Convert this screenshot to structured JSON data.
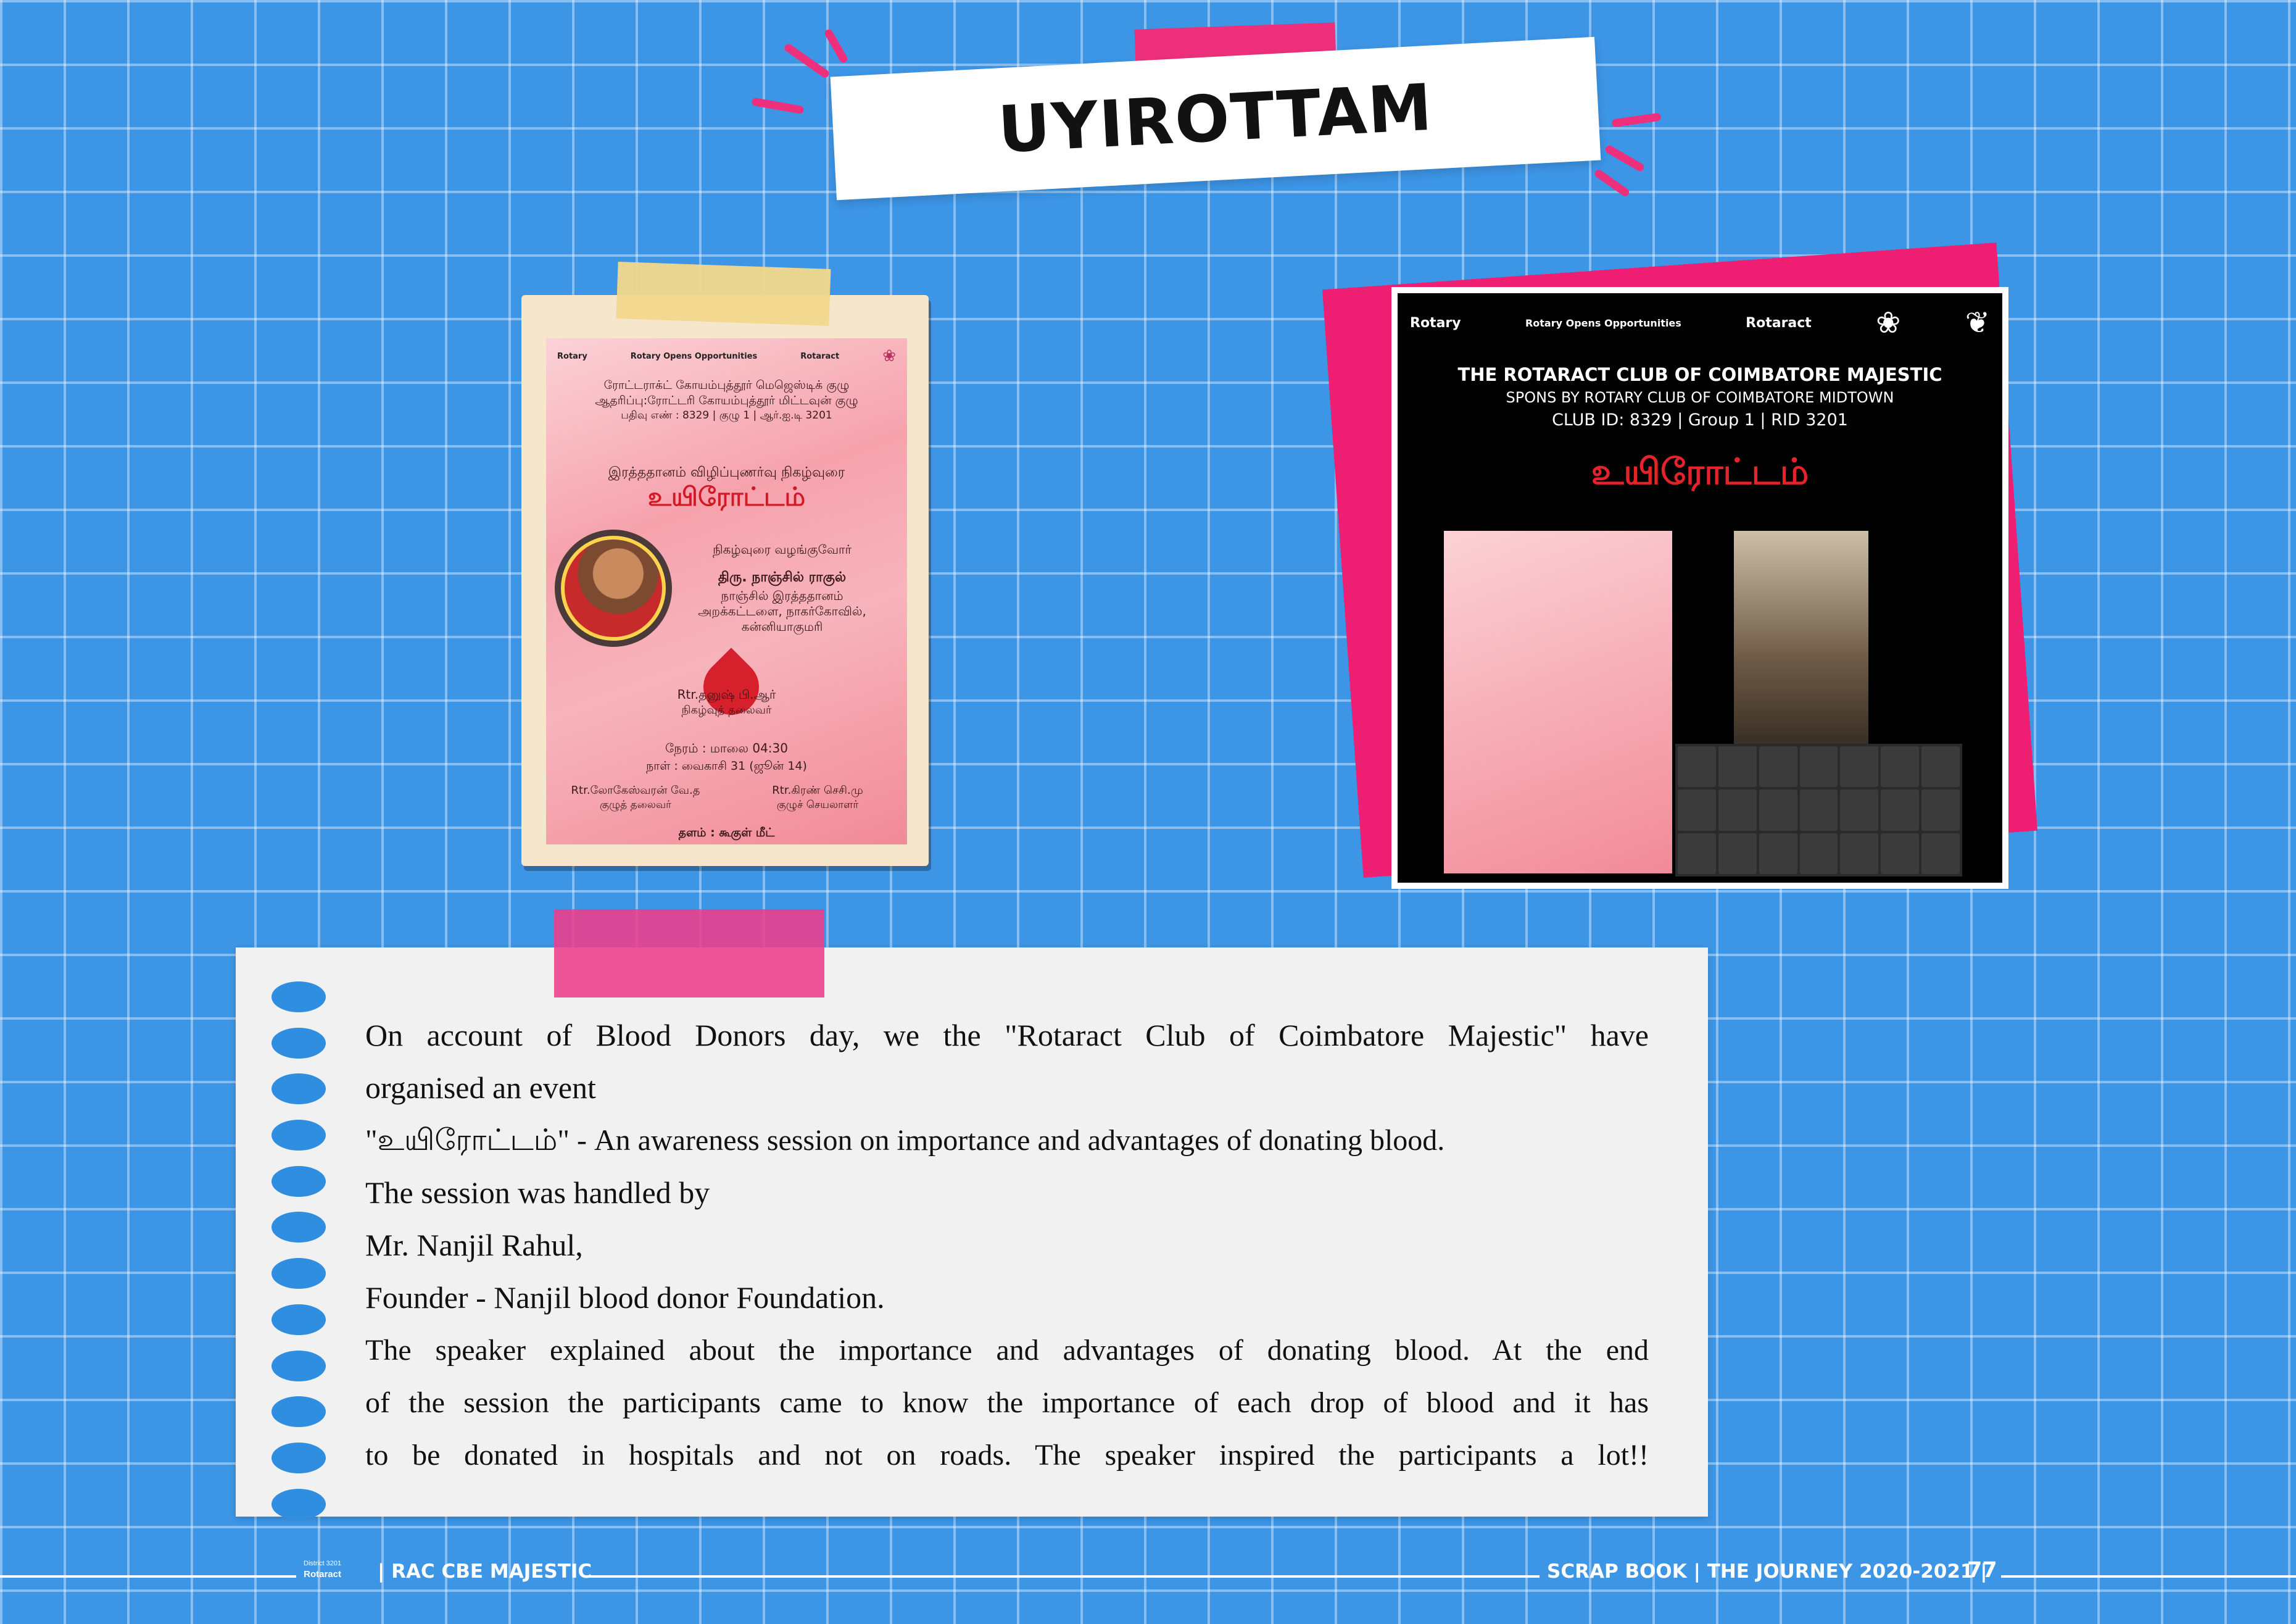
{
  "title": "UYIROTTAM",
  "poster": {
    "logos": [
      "Rotary",
      "Rotary Opens Opportunities",
      "Rotaract"
    ],
    "org_lines": [
      "ரோட்டராக்ட் கோயம்புத்தூர் மெஜெஸ்டிக் குழு",
      "ஆதரிப்பு:ரோட்டரி கோயம்புத்தூர் மிட்டவுன் குழு",
      "பதிவு எண் : 8329 | குழு 1 | ஆர்.ஐ.டி 3201"
    ],
    "event_line": "இரத்ததானம் விழிப்புணர்வு நிகழ்வுரை",
    "event_name": "உயிரோட்டம்",
    "presenter_label": "நிகழ்வுரை வழங்குவோர்",
    "speaker_name": "திரு. நாஞ்சில் ராகுல்",
    "speaker_org": [
      "நாஞ்சில் இரத்ததானம்",
      "அறக்கட்டளை, நாகர்கோவில்,",
      "கன்னியாகுமரி"
    ],
    "host_name": "Rtr.தனுஷ் பி.ஆர்",
    "host_role": "நிகழ்வுத் தலைவர்",
    "time": "நேரம் : மாலை 04:30",
    "date": "நாள் : வைகாசி 31 (ஜூன் 14)",
    "left_person": "Rtr.லோகேஸ்வரன் வே.த",
    "left_role": "குழுத் தலைவர்",
    "right_person": "Rtr.கிரண் செசி.மு",
    "right_role": "குழுச் செயலாளர்",
    "venue": "தளம் : கூகுள் மீட்"
  },
  "screenshot": {
    "logos": [
      "Rotary",
      "Rotary Opens Opportunities",
      "Rotaract"
    ],
    "club": "THE ROTARACT CLUB OF COIMBATORE MAJESTIC",
    "spons": "SPONS BY ROTARY CLUB OF COIMBATORE MIDTOWN",
    "club_id": "CLUB ID: 8329 | Group 1 | RID 3201",
    "event_name": "உயிரோட்டம்"
  },
  "description": {
    "line1": "On account of Blood Donors day, we the \"Rotaract Club of Coimbatore Majestic\" have",
    "line2": "organised an event",
    "line3": "\"உயிரோட்டம்\" - An awareness session on importance and advantages of donating blood.",
    "line4": "The session was handled by",
    "line5": "Mr. Nanjil Rahul,",
    "line6": "Founder - Nanjil blood donor Foundation.",
    "line7": "The speaker explained about the importance and advantages of donating blood. At the end",
    "line8": "of the session the participants came to know the importance of each drop of blood and it has",
    "line9": "to be donated in hospitals and not on roads. The speaker inspired the participants a lot!!"
  },
  "footer": {
    "logo_top": "District 3201",
    "logo_name": "Rotaract",
    "left": "| RAC CBE MAJESTIC",
    "right": "SCRAP BOOK | THE JOURNEY 2020-2021 |",
    "page": "77"
  },
  "colors": {
    "background": "#3d95e6",
    "accent_pink": "#ee2f7c",
    "blood_red": "#e5232b"
  }
}
